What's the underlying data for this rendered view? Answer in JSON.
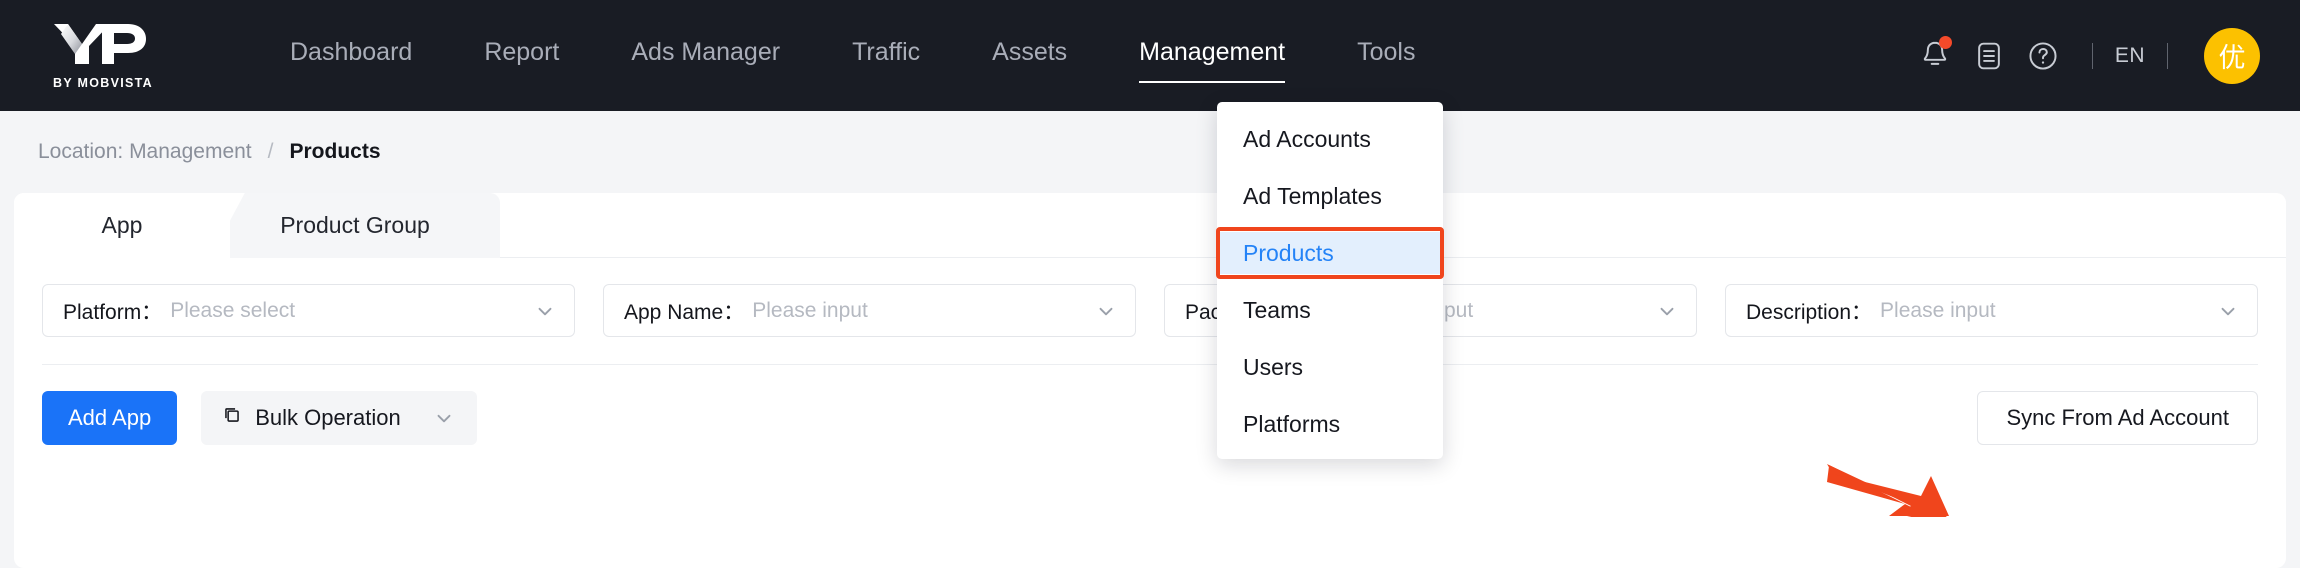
{
  "brand": {
    "name": "XMP",
    "tagline": "BY MOBVISTA"
  },
  "nav": {
    "items": [
      {
        "label": "Dashboard",
        "active": false
      },
      {
        "label": "Report",
        "active": false
      },
      {
        "label": "Ads Manager",
        "active": false
      },
      {
        "label": "Traffic",
        "active": false
      },
      {
        "label": "Assets",
        "active": false
      },
      {
        "label": "Management",
        "active": true
      },
      {
        "label": "Tools",
        "active": false
      }
    ],
    "right": {
      "notification_icon": "bell-icon",
      "has_notification_badge": true,
      "docs_icon": "document-list-icon",
      "help_icon": "question-circle-icon",
      "language": "EN",
      "avatar_text": "优",
      "avatar_color": "#fcc100"
    }
  },
  "breadcrumb": {
    "location": "Location: Management",
    "separator": "/",
    "current": "Products"
  },
  "dropdown": {
    "open": true,
    "items": [
      {
        "label": "Ad Accounts",
        "selected": false
      },
      {
        "label": "Ad Templates",
        "selected": false
      },
      {
        "label": "Products",
        "selected": true
      },
      {
        "label": "Teams",
        "selected": false
      },
      {
        "label": "Users",
        "selected": false
      },
      {
        "label": "Platforms",
        "selected": false
      }
    ],
    "highlight_color": "#f0451c",
    "selected_text_color": "#2483f7",
    "selected_bg_color": "#e3effd"
  },
  "tabs": [
    {
      "label": "App",
      "active": true
    },
    {
      "label": "Product Group",
      "active": false
    }
  ],
  "filters": [
    {
      "label": "Platform：",
      "value": "Please select",
      "icon": "chevron-down-icon"
    },
    {
      "label": "App Name：",
      "value": "Please input",
      "icon": "chevron-down-icon"
    },
    {
      "label": "Package Name：",
      "value": "Please input",
      "icon": "chevron-down-icon"
    },
    {
      "label": "Description：",
      "value": "Please input",
      "icon": "chevron-down-icon"
    }
  ],
  "actions": {
    "add_app": "Add App",
    "bulk_operation": "Bulk Operation",
    "sync_from_ad_account": "Sync From Ad Account",
    "primary_color": "#1a73f8",
    "annotation_arrow_color": "#f0451c"
  }
}
